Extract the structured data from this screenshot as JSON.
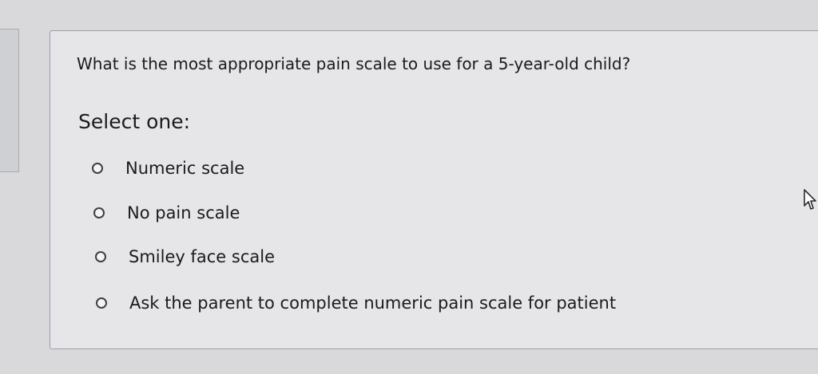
{
  "question": {
    "text": "What is the most appropriate pain scale to use for a 5-year-old child?",
    "prompt": "Select one:"
  },
  "options": [
    {
      "label": "Numeric scale",
      "selected": false
    },
    {
      "label": "No pain scale",
      "selected": false
    },
    {
      "label": "Smiley face scale",
      "selected": false
    },
    {
      "label": "Ask the parent to complete numeric pain scale for patient",
      "selected": false
    }
  ],
  "icons": {
    "cursor": "mouse-pointer-icon"
  }
}
